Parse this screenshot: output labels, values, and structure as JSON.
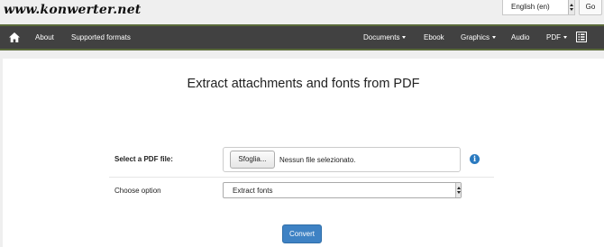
{
  "site": {
    "logo": "www.konwerter.net"
  },
  "language": {
    "selected": "English (en)",
    "go_label": "Go"
  },
  "nav": {
    "left": [
      {
        "label": "About"
      },
      {
        "label": "Supported formats"
      }
    ],
    "right": [
      {
        "label": "Documents",
        "dropdown": true
      },
      {
        "label": "Ebook",
        "dropdown": false
      },
      {
        "label": "Graphics",
        "dropdown": true
      },
      {
        "label": "Audio",
        "dropdown": false
      },
      {
        "label": "PDF",
        "dropdown": true
      }
    ],
    "icons": [
      "home-icon",
      "list-icon"
    ]
  },
  "main": {
    "title": "Extract attachments and fonts from PDF",
    "file_field": {
      "label": "Select a PDF file:",
      "browse_label": "Sfoglia...",
      "status": "Nessun file selezionato."
    },
    "option_field": {
      "label": "Choose option",
      "selected": "Extract fonts"
    },
    "convert_label": "Convert"
  },
  "colors": {
    "navbar": "#414141",
    "navbar_border": "#5a6a3a",
    "accent": "#3e82c4",
    "info": "#2a7ac0"
  }
}
